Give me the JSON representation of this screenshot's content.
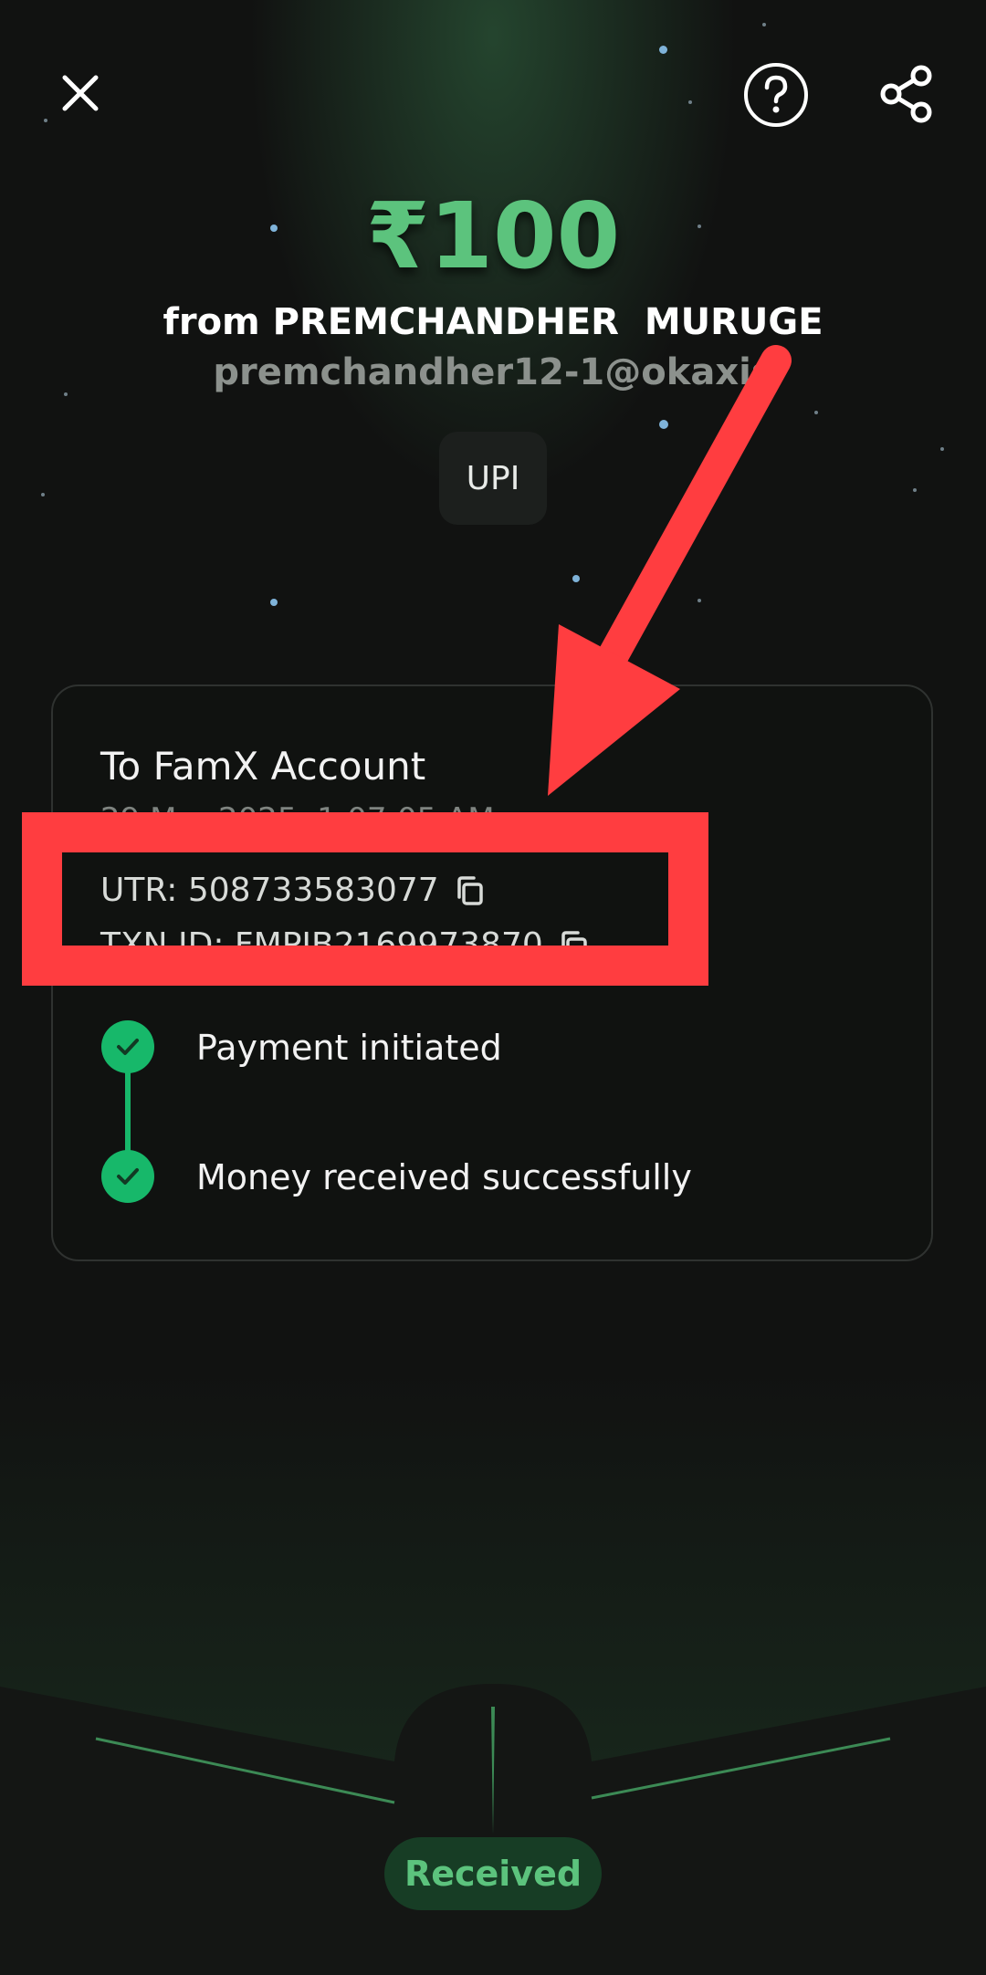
{
  "header": {
    "close_icon": "close-icon",
    "help_icon": "help-icon",
    "share_icon": "share-icon"
  },
  "transaction": {
    "amount": "₹100",
    "from_line": "from PREMCHANDHER  MURUGE",
    "vpa": "premchandher12-1@okaxis",
    "method": "UPI"
  },
  "card": {
    "title": "To FamX Account",
    "date": "29 Mar 2025, 1:07:05 AM",
    "utr_label": "UTR: 508733583077",
    "txn_label": "TXN ID: FMPIB2169973870"
  },
  "steps": [
    {
      "label": "Payment initiated"
    },
    {
      "label": "Money received successfully"
    }
  ],
  "status": {
    "label": "Received"
  },
  "colors": {
    "accent_green": "#5cc37d",
    "step_green": "#17b86a",
    "annotation_red": "#ff3d40"
  }
}
